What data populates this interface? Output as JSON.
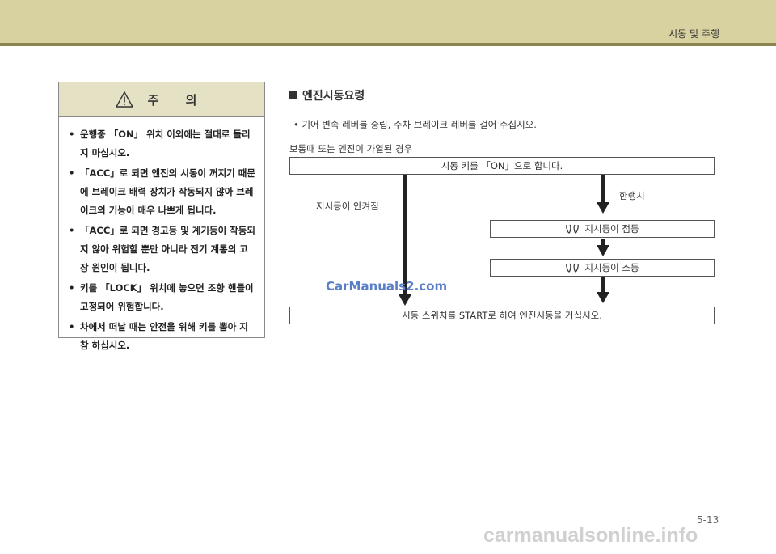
{
  "header": {
    "section": "시동 및 주행"
  },
  "caution": {
    "title": "주 의",
    "items": [
      "운행중 「ON」 위치 이외에는 절대로 돌리지 마십시오.",
      "「ACC」로 되면 엔진의 시동이 꺼지기 때문에 브레이크 배력 장치가 작동되지 않아 브레이크의 기능이 매우 나쁘게 됩니다.",
      "「ACC」로 되면 경고등 및 계기등이 작동되지 않아 위험할 뿐만 아니라 전기 계통의 고장 원인이 됩니다.",
      "키를 「LOCK」 위치에 놓으면 조향 핸들이 고정되어 위험합니다.",
      "차에서 떠날 때는 안전을 위해 키를 뽑아 지참 하십시오."
    ]
  },
  "engine_start": {
    "title": "엔진시동요령",
    "bullet": "기어 변속 레버를 중립, 주차 브레이크 레버를 걸어 주십시오.",
    "condition": "보통때 또는 엔진이 가열된 경우",
    "flow": {
      "step_key_on": "시동 키를 「ON」으로 합니다.",
      "label_cold": "한랭시",
      "label_no_light": "지시등이 안켜짐",
      "step_indicator_on": "지시등이 점등",
      "step_indicator_off": "지시등이 소등",
      "step_start": "시동 스위치를 START로 하여 엔진시동을 거십시오."
    }
  },
  "watermark": "CarManuals2.com",
  "page_number": "5-13",
  "footer_watermark": "carmanualsonline.info"
}
